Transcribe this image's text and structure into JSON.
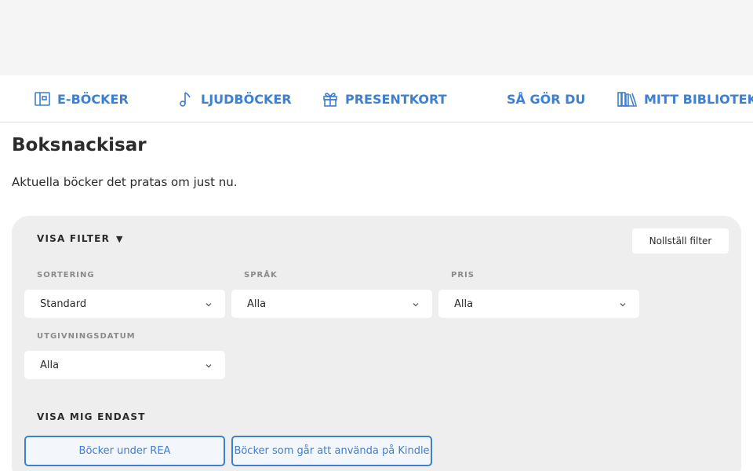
{
  "nav": {
    "items": [
      {
        "label": "E-BÖCKER",
        "icon": "book-icon"
      },
      {
        "label": "LJUDBÖCKER",
        "icon": "music-note-icon"
      },
      {
        "label": "PRESENTKORT",
        "icon": "gift-icon"
      },
      {
        "label": "SÅ GÖR DU",
        "icon": ""
      },
      {
        "label": "MITT BIBLIOTEK",
        "icon": "library-icon"
      }
    ],
    "accent": "#3d7fd1"
  },
  "page": {
    "title": "Boksnackisar",
    "subtitle": "Aktuella böcker det pratas om just nu."
  },
  "filters": {
    "toggle_label": "VISA FILTER",
    "reset_label": "Nollställ filter",
    "sort": {
      "label": "SORTERING",
      "value": "Standard"
    },
    "language": {
      "label": "SPRÅK",
      "value": "Alla"
    },
    "price": {
      "label": "PRIS",
      "value": "Alla"
    },
    "release": {
      "label": "UTGIVNINGSDATUM",
      "value": "Alla"
    },
    "only": {
      "label": "VISA MIG ENDAST",
      "options": [
        "Böcker under REA",
        "Böcker som går att använda på Kindle"
      ]
    }
  }
}
